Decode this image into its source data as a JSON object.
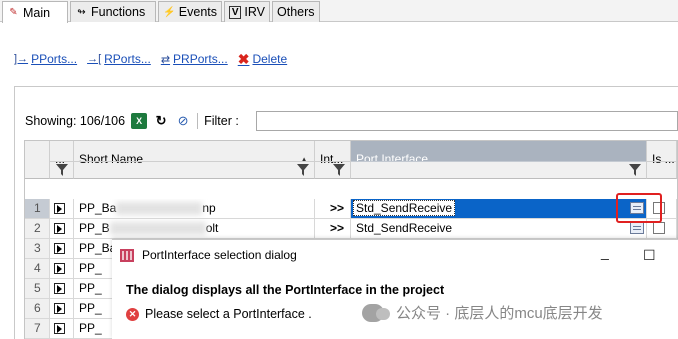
{
  "tabs": [
    {
      "label": "Main",
      "icon": "main-icon"
    },
    {
      "label": "Functions",
      "icon": "functions-icon"
    },
    {
      "label": "Events",
      "icon": "events-icon"
    },
    {
      "label": "IRV",
      "icon": "irv-icon"
    },
    {
      "label": "Others",
      "icon": "others-icon"
    }
  ],
  "actions": {
    "pports": "PPorts...",
    "rports": "RPorts...",
    "prports": "PRPorts...",
    "delete": "Delete"
  },
  "toolbar": {
    "showing": "Showing: 106/106",
    "filter_label": "Filter :",
    "filter_value": ""
  },
  "grid": {
    "columns": {
      "expand": "...",
      "short_name": "Short Name",
      "int": "Int...",
      "port_interface": "Port Interface",
      "is": "Is ..."
    },
    "rows": [
      {
        "num": "1",
        "name_prefix": "PP_Ba",
        "name_suffix": "np",
        "int": ">>",
        "port_interface": "Std_SendReceive"
      },
      {
        "num": "2",
        "name_prefix": "PP_B",
        "name_suffix": "olt",
        "int": ">>",
        "port_interface": "Std_SendReceive"
      },
      {
        "num": "3",
        "name_prefix": "PP_Ba",
        "name_suffix": "",
        "int": "",
        "port_interface": ""
      },
      {
        "num": "4",
        "name_prefix": "PP_",
        "name_suffix": "",
        "int": "",
        "port_interface": ""
      },
      {
        "num": "5",
        "name_prefix": "PP_",
        "name_suffix": "",
        "int": "",
        "port_interface": ""
      },
      {
        "num": "6",
        "name_prefix": "PP_",
        "name_suffix": "",
        "int": "",
        "port_interface": ""
      },
      {
        "num": "7",
        "name_prefix": "PP_",
        "name_suffix": "",
        "int": "",
        "port_interface": ""
      }
    ]
  },
  "dialog": {
    "title": "PortInterface selection dialog",
    "minimize": "_",
    "maximize": "☐",
    "heading": "The dialog displays all the PortInterface in the project",
    "message": "Please select a PortInterface ."
  },
  "watermark": "公众号 · 底层人的mcu底层开发",
  "colors": {
    "selection_blue": "#0a64c8",
    "highlight_red": "#e02020",
    "link_blue": "#1a4fb8"
  }
}
